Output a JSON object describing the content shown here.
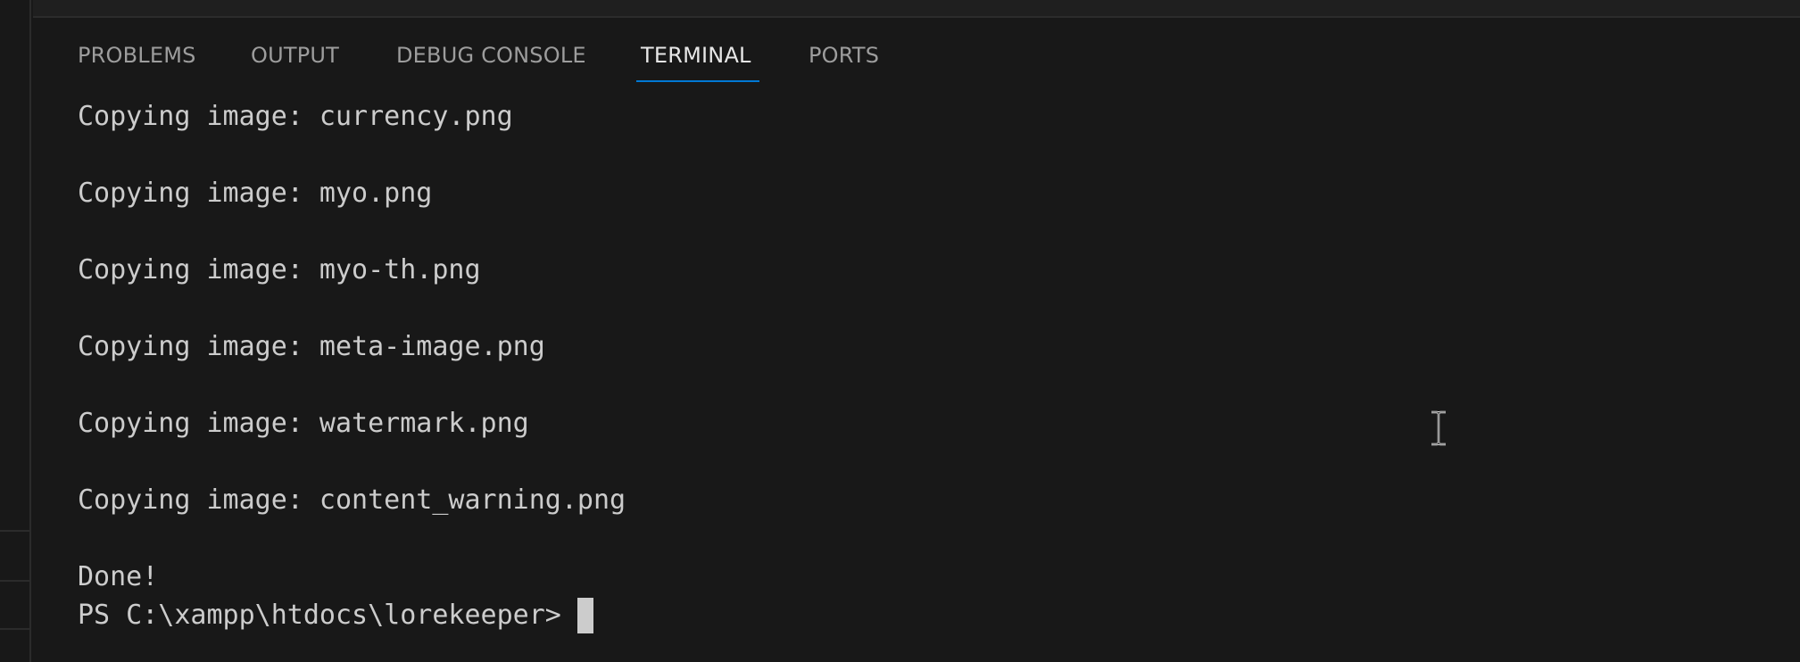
{
  "panel": {
    "tabs": [
      {
        "label": "PROBLEMS",
        "active": false
      },
      {
        "label": "OUTPUT",
        "active": false
      },
      {
        "label": "DEBUG CONSOLE",
        "active": false
      },
      {
        "label": "TERMINAL",
        "active": true
      },
      {
        "label": "PORTS",
        "active": false
      }
    ],
    "accent_color": "#0078d4"
  },
  "terminal": {
    "lines": [
      "Copying image: currency.png",
      "Copying image: myo.png",
      "Copying image: myo-th.png",
      "Copying image: meta-image.png",
      "Copying image: watermark.png",
      "Copying image: content_warning.png",
      "Done!"
    ],
    "prompt": "PS C:\\xampp\\htdocs\\lorekeeper>"
  },
  "icons": {
    "text_cursor": "ibeam-cursor-icon",
    "terminal_cursor": "block-cursor-icon"
  }
}
